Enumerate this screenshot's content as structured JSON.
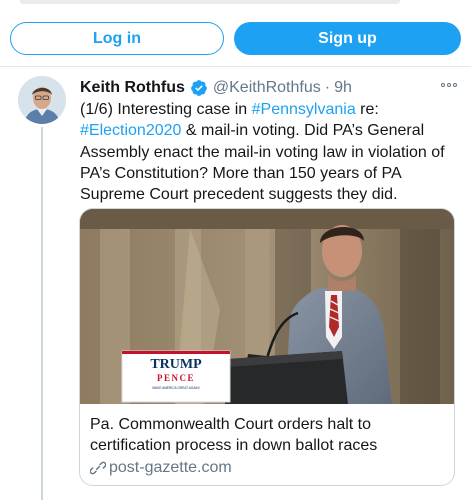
{
  "actions": {
    "login_label": "Log in",
    "signup_label": "Sign up"
  },
  "tweet": {
    "author_name": "Keith Rothfus",
    "handle": "@KeithRothfus",
    "separator": "·",
    "time": "9h",
    "text": {
      "part1": "(1/6) Interesting case in ",
      "hashtag1": "#Pennsylvania",
      "part2": " re: ",
      "hashtag2": "#Election2020",
      "part3": " & mail-in voting. Did PA’s General Assembly enact the mail-in voting law in violation of PA’s Constitution? More than 150 years of PA Supreme Court precedent suggests they did."
    }
  },
  "card": {
    "title": "Pa. Commonwealth Court orders halt to certification process in down ballot races",
    "domain": "post-gazette.com",
    "sign": {
      "line1": "TRUMP",
      "line2": "PENCE",
      "line3": "MAKE AMERICA GREAT AGAIN!"
    }
  },
  "colors": {
    "accent": "#1da1f2",
    "secondary_text": "#657786",
    "border": "#ccd6dd"
  },
  "icons": {
    "verified": "verified-badge-icon",
    "more": "more-options-icon",
    "link": "link-icon"
  }
}
